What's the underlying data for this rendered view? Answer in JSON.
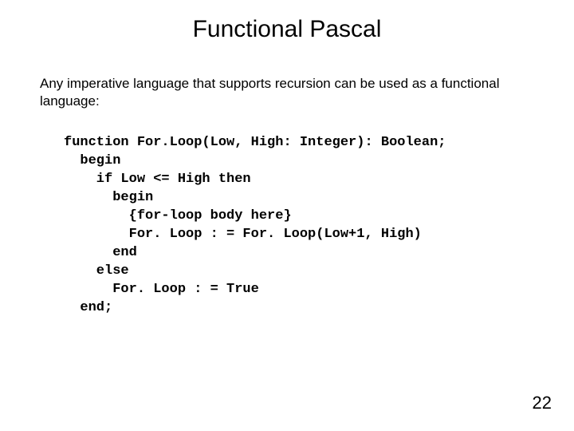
{
  "title": "Functional Pascal",
  "intro": "Any imperative language that supports recursion can be used as a functional language:",
  "code": "function For.Loop(Low, High: Integer): Boolean;\n  begin\n    if Low <= High then\n      begin\n        {for-loop body here}\n        For. Loop : = For. Loop(Low+1, High)\n      end\n    else\n      For. Loop : = True\n  end;",
  "page_number": "22"
}
